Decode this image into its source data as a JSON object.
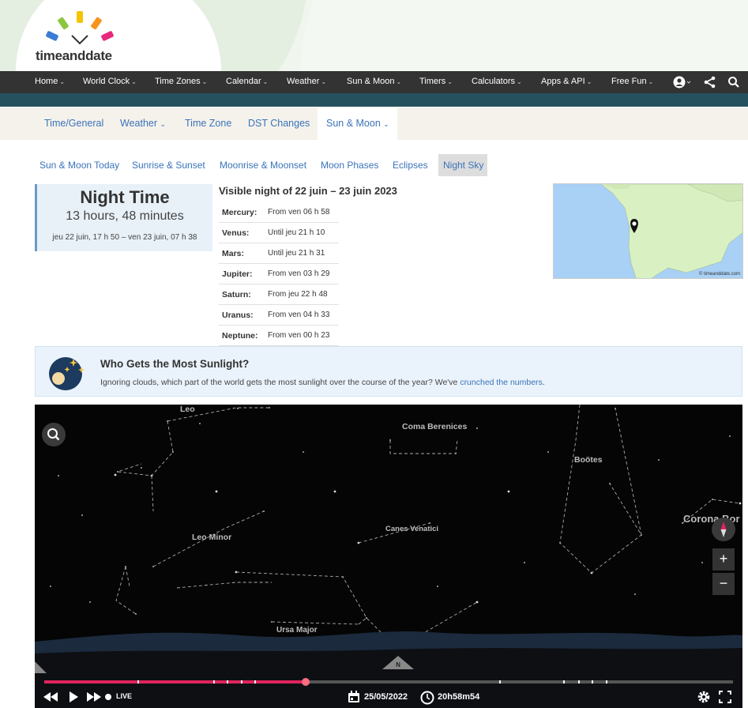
{
  "header": {
    "logo_text": "timeanddate"
  },
  "main_nav": [
    {
      "label": "Home"
    },
    {
      "label": "World Clock"
    },
    {
      "label": "Time Zones"
    },
    {
      "label": "Calendar"
    },
    {
      "label": "Weather"
    },
    {
      "label": "Sun & Moon"
    },
    {
      "label": "Timers"
    },
    {
      "label": "Calculators"
    },
    {
      "label": "Apps & API"
    },
    {
      "label": "Free Fun"
    }
  ],
  "sub_nav": [
    {
      "label": "Time/General"
    },
    {
      "label": "Weather"
    },
    {
      "label": "Time Zone"
    },
    {
      "label": "DST Changes"
    },
    {
      "label": "Sun & Moon"
    }
  ],
  "tabs": [
    {
      "label": "Sun & Moon Today"
    },
    {
      "label": "Sunrise & Sunset"
    },
    {
      "label": "Moonrise & Moonset"
    },
    {
      "label": "Moon Phases"
    },
    {
      "label": "Eclipses"
    },
    {
      "label": "Night Sky"
    }
  ],
  "night_box": {
    "title": "Night Time",
    "duration": "13 hours, 48 minutes",
    "range": "jeu 22 juin, 17 h 50 – ven 23 juin, 07 h 38"
  },
  "visible": {
    "title": "Visible night of 22 juin – 23 juin 2023",
    "planets": [
      {
        "name": "Mercury:",
        "value": "From ven 06 h 58"
      },
      {
        "name": "Venus:",
        "value": "Until jeu 21 h 10"
      },
      {
        "name": "Mars:",
        "value": "Until jeu 21 h 31"
      },
      {
        "name": "Jupiter:",
        "value": "From ven 03 h 29"
      },
      {
        "name": "Saturn:",
        "value": "From jeu 22 h 48"
      },
      {
        "name": "Uranus:",
        "value": "From ven 04 h 33"
      },
      {
        "name": "Neptune:",
        "value": "From ven 00 h 23"
      }
    ]
  },
  "map": {
    "credit": "© timeanddate.com"
  },
  "promo": {
    "title": "Who Gets the Most Sunlight?",
    "text": "Ignoring clouds, which part of the world gets the most sunlight over the course of the year? We've",
    "link": "crunched the numbers",
    "end": "."
  },
  "sky": {
    "constellations": [
      {
        "name": "Leo"
      },
      {
        "name": "Coma Berenices"
      },
      {
        "name": "Boötes"
      },
      {
        "name": "Corona Bor"
      },
      {
        "name": "Canes Venatici"
      },
      {
        "name": "Leo Minor"
      },
      {
        "name": "Ursa Major"
      }
    ],
    "compass": "N",
    "live_label": "LIVE",
    "date": "25/05/2022",
    "time": "20h58m54",
    "timeline_progress": 0.38
  },
  "colors": {
    "accent": "#e0245e",
    "nav": "#333333",
    "band": "#25515f",
    "link": "#3a73b8"
  }
}
